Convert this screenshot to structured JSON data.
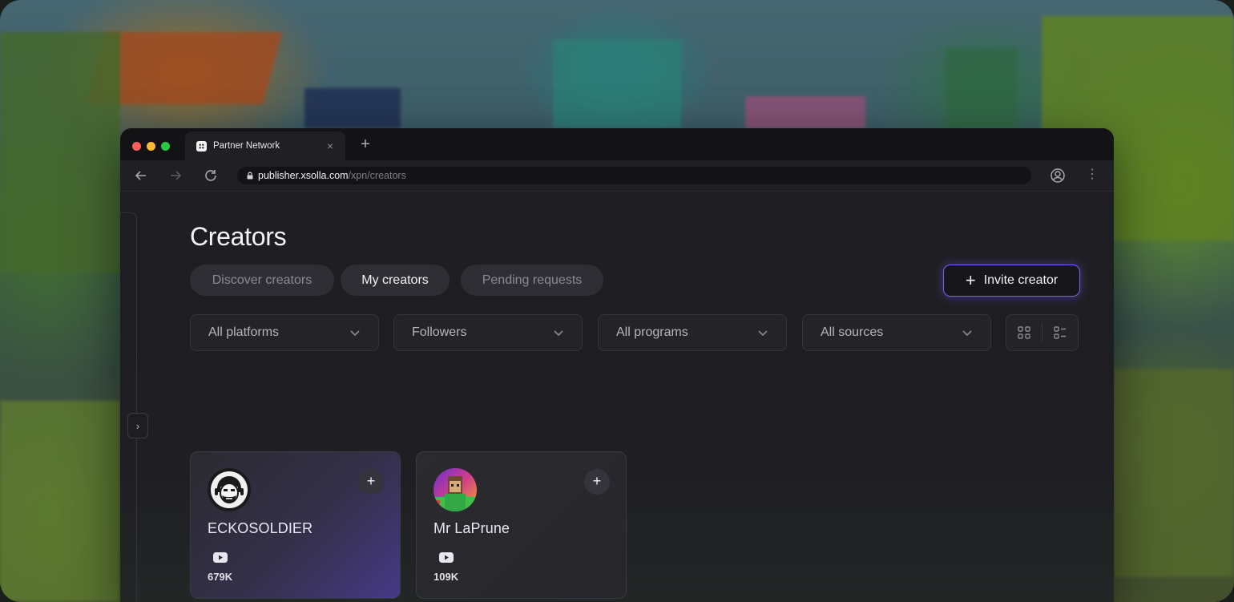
{
  "browser": {
    "tab_title": "Partner Network",
    "url_host": "publisher.xsolla.com",
    "url_path": "/xpn/creators"
  },
  "page": {
    "title": "Creators",
    "tabs": [
      {
        "label": "Discover creators",
        "active": false
      },
      {
        "label": "My creators",
        "active": true
      },
      {
        "label": "Pending requests",
        "active": false
      }
    ],
    "invite_label": "Invite creator",
    "filters": [
      "All platforms",
      "Followers",
      "All programs",
      "All sources"
    ]
  },
  "creators": [
    {
      "name": "ECKOSOLDIER",
      "platform": "youtube-icon",
      "followers": "679K"
    },
    {
      "name": "Mr LaPrune",
      "platform": "youtube-icon",
      "followers": "109K"
    }
  ],
  "colors": {
    "accent": "#7a5cf5",
    "traffic_red": "#ff5f57",
    "traffic_yellow": "#febc2e",
    "traffic_green": "#28c840"
  }
}
